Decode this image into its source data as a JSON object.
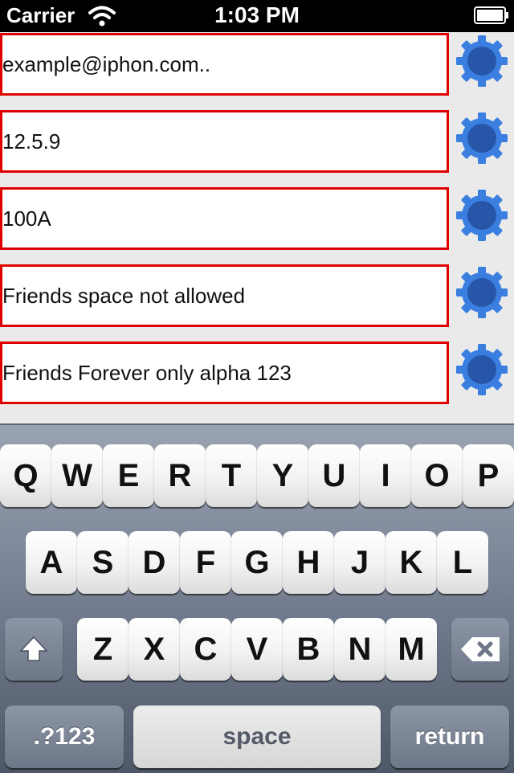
{
  "status_bar": {
    "carrier": "Carrier",
    "time": "1:03 PM",
    "wifi_icon": "wifi-icon",
    "battery_icon": "battery-icon"
  },
  "form": {
    "fields": [
      {
        "value": "example@iphon.com..",
        "accessory_icon": "gear-icon"
      },
      {
        "value": "12.5.9",
        "accessory_icon": "gear-icon"
      },
      {
        "value": "100A",
        "accessory_icon": "gear-icon"
      },
      {
        "value": "Friends space not allowed",
        "accessory_icon": "gear-icon"
      },
      {
        "value": "Friends Forever only alpha 123",
        "accessory_icon": "gear-icon"
      }
    ]
  },
  "keyboard": {
    "row1": [
      "Q",
      "W",
      "E",
      "R",
      "T",
      "Y",
      "U",
      "I",
      "O",
      "P"
    ],
    "row2": [
      "A",
      "S",
      "D",
      "F",
      "G",
      "H",
      "J",
      "K",
      "L"
    ],
    "row3": [
      "Z",
      "X",
      "C",
      "V",
      "B",
      "N",
      "M"
    ],
    "shift_icon": "shift-arrow-icon",
    "delete_icon": "delete-backspace-icon",
    "numbers_label": ".?123",
    "space_label": "space",
    "return_label": "return"
  },
  "colors": {
    "field_border": "#e00000",
    "gear": "#3a7fe0",
    "gear_inner": "#2756a8"
  }
}
